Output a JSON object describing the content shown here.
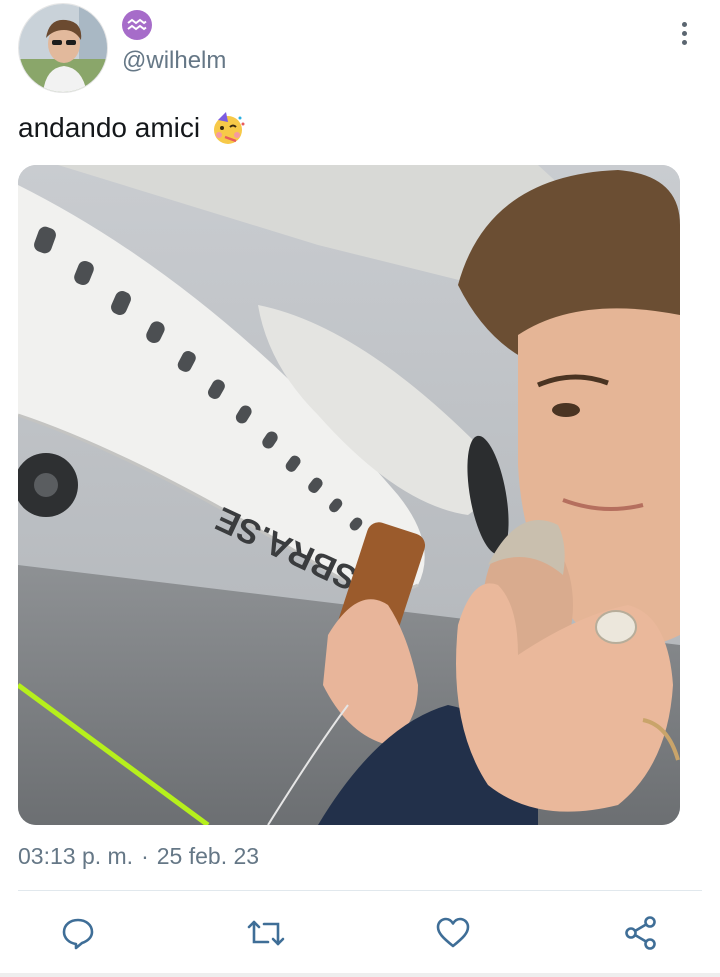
{
  "user": {
    "handle": "@wilhelm",
    "badge_icon": "aquarius-icon",
    "badge_color": "#a66cc9"
  },
  "tweet": {
    "text": "andando amici",
    "emoji": "partying-face"
  },
  "media": {
    "description_icon": "photo",
    "visible_text": "SBRA.SE"
  },
  "timestamp": {
    "time": "03:13 p. m.",
    "separator": "·",
    "date": "25 feb. 23"
  },
  "actions": [
    "reply-icon",
    "retweet-icon",
    "like-icon",
    "share-icon"
  ],
  "colors": {
    "text": "#14171a",
    "secondary": "#657786",
    "icon": "#3f6e97"
  }
}
